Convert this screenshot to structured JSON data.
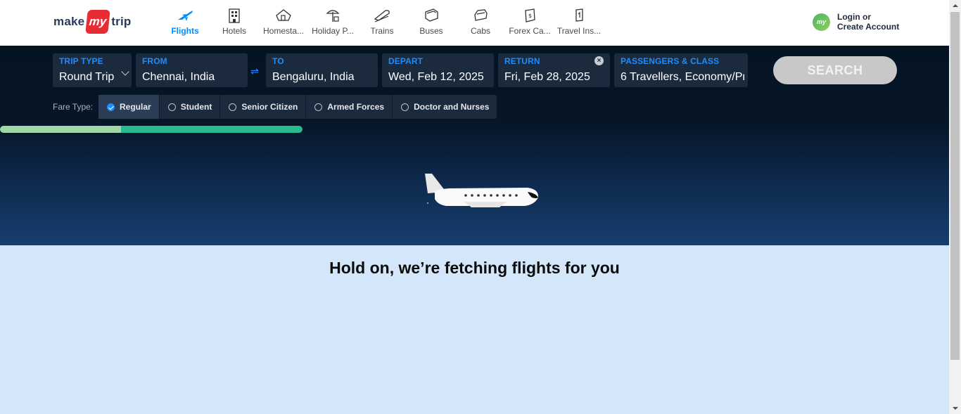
{
  "header": {
    "logo": {
      "make": "make",
      "my": "my",
      "trip": "trip"
    },
    "nav": [
      {
        "label": "Flights",
        "icon": "flight-icon",
        "active": true
      },
      {
        "label": "Hotels",
        "icon": "hotel-icon"
      },
      {
        "label": "Homesta...",
        "icon": "homestay-icon"
      },
      {
        "label": "Holiday P...",
        "icon": "holiday-package-icon"
      },
      {
        "label": "Trains",
        "icon": "train-icon"
      },
      {
        "label": "Buses",
        "icon": "bus-icon"
      },
      {
        "label": "Cabs",
        "icon": "cab-icon"
      },
      {
        "label": "Forex Ca...",
        "icon": "forex-card-icon"
      },
      {
        "label": "Travel Ins...",
        "icon": "travel-insurance-icon"
      }
    ],
    "login": {
      "avatar": "my",
      "line1": "Login or",
      "line2": "Create Account"
    }
  },
  "search": {
    "trip_type": {
      "label": "TRIP TYPE",
      "value": "Round Trip"
    },
    "from": {
      "label": "FROM",
      "value": "Chennai, India"
    },
    "swap_symbol": "⇌",
    "to": {
      "label": "TO",
      "value": "Bengaluru, India"
    },
    "depart": {
      "label": "DEPART",
      "value": "Wed, Feb 12, 2025"
    },
    "return": {
      "label": "RETURN",
      "value": "Fri, Feb 28, 2025",
      "clear": "×"
    },
    "passengers": {
      "label": "PASSENGERS & CLASS",
      "value": "6 Travellers, Economy/Pr"
    },
    "button": "SEARCH"
  },
  "fare": {
    "label": "Fare Type:",
    "options": [
      {
        "label": "Regular",
        "selected": true
      },
      {
        "label": "Student",
        "selected": false
      },
      {
        "label": "Senior Citizen",
        "selected": false
      },
      {
        "label": "Armed Forces",
        "selected": false
      },
      {
        "label": "Doctor and Nurses",
        "selected": false
      }
    ]
  },
  "loading": {
    "progress_fraction": 0.4,
    "message": "Hold on, we’re fetching flights for you"
  },
  "colors": {
    "accent": "#008cff",
    "brand_red": "#e82c33",
    "progress": "#2bb98e",
    "background": "#d3e6fa"
  }
}
